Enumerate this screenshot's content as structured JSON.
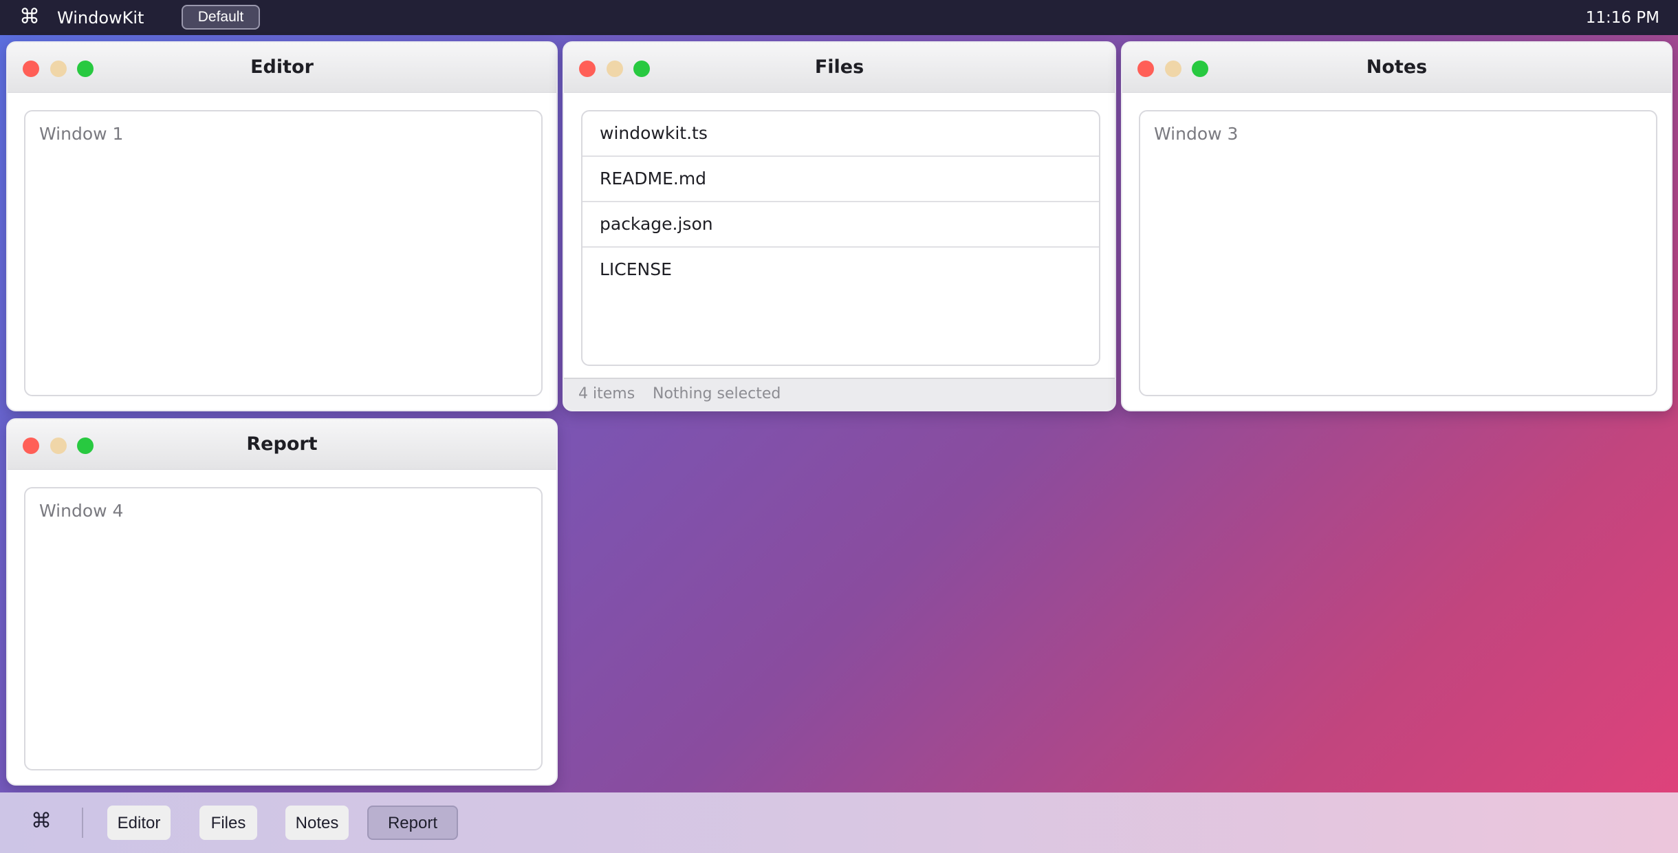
{
  "menubar": {
    "command_glyph": "⌘",
    "app_name": "WindowKit",
    "layout_button": "Default",
    "clock": "11:16 PM"
  },
  "windows": [
    {
      "title": "Editor",
      "content": "Window 1",
      "controls": [
        "close",
        "minimize",
        "maximize"
      ]
    },
    {
      "title": "Files",
      "controls": [
        "close",
        "minimize",
        "maximize"
      ]
    },
    {
      "title": "Notes",
      "content": "Window 3",
      "controls": [
        "close",
        "minimize",
        "maximize"
      ]
    },
    {
      "title": "Report",
      "content": "Window 4",
      "controls": [
        "close",
        "minimize",
        "maximize"
      ]
    }
  ],
  "files": {
    "items": [
      "windowkit.ts",
      "README.md",
      "package.json",
      "LICENSE"
    ],
    "status_count": "4 items",
    "status_selection": "Nothing selected"
  },
  "dock": {
    "command_glyph": "⌘",
    "items": [
      "Editor",
      "Files",
      "Notes",
      "Report"
    ],
    "active": "Report"
  },
  "colors": {
    "close": "#ff5f57",
    "minimize": "#f0d6a8",
    "maximize": "#28c940",
    "menubar": "#222036"
  }
}
